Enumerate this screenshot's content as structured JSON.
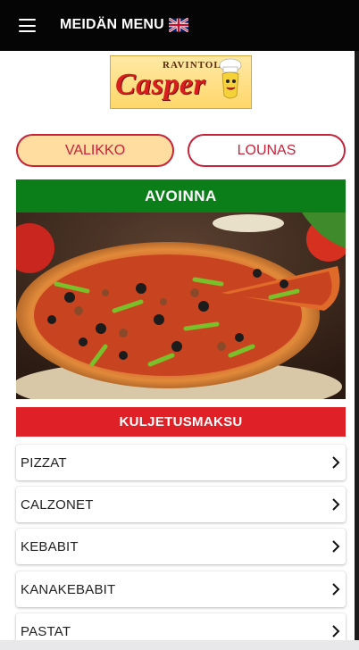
{
  "header": {
    "title": "MEIDÄN MENU",
    "menu_icon": "hamburger-icon",
    "language_icon": "uk-flag-icon"
  },
  "logo": {
    "line1": "RAVINTOLA",
    "line2": "Casper"
  },
  "tabs": [
    {
      "label": "VALIKKO",
      "active": true
    },
    {
      "label": "LOUNAS",
      "active": false
    }
  ],
  "status": {
    "label": "AVOINNA",
    "color": "#0b7e1a"
  },
  "hero": {
    "image_icon": "pizza-photo"
  },
  "delivery": {
    "label": "KULJETUSMAKSU",
    "color": "#e02027"
  },
  "categories": [
    {
      "label": "PIZZAT"
    },
    {
      "label": "CALZONET"
    },
    {
      "label": "KEBABIT"
    },
    {
      "label": "KANAKEBABIT"
    },
    {
      "label": "PASTAT"
    }
  ],
  "colors": {
    "accent": "#c8223a",
    "active_tab_bg": "#ffdca0",
    "header_bg": "#050505"
  }
}
